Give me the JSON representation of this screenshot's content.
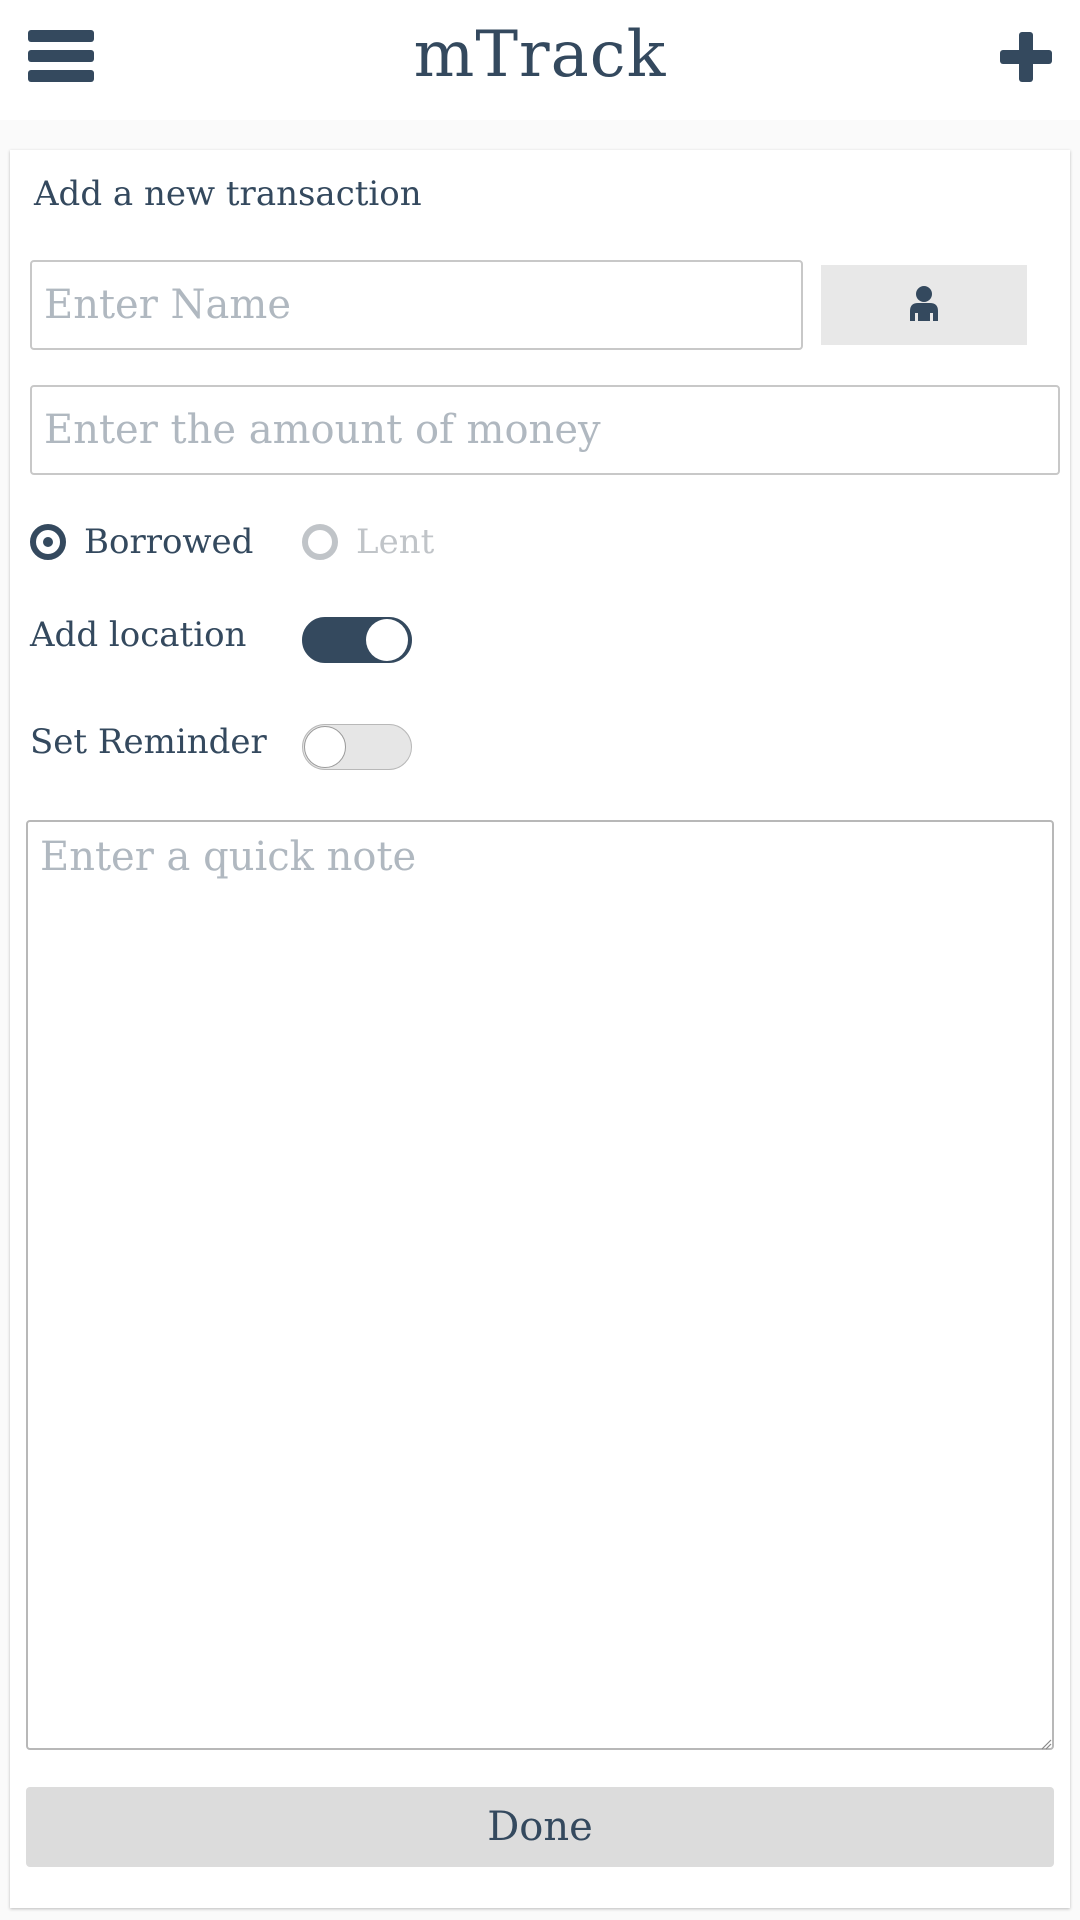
{
  "header": {
    "title": "mTrack",
    "menu_icon": "hamburger-menu-icon",
    "add_icon": "plus-icon"
  },
  "form": {
    "heading": "Add a new transaction",
    "name_placeholder": "Enter Name",
    "contact_icon": "person-icon",
    "amount_placeholder": "Enter the amount of money",
    "type_options": [
      {
        "label": "Borrowed",
        "selected": true
      },
      {
        "label": "Lent",
        "selected": false
      }
    ],
    "location_label": "Add location",
    "location_enabled": true,
    "reminder_label": "Set Reminder",
    "reminder_enabled": false,
    "note_placeholder": "Enter a quick note",
    "done_label": "Done"
  },
  "colors": {
    "primary": "#34495e",
    "placeholder": "#b0b8c0",
    "disabled": "#c0c4c8",
    "button_bg": "#dcdcdc"
  }
}
